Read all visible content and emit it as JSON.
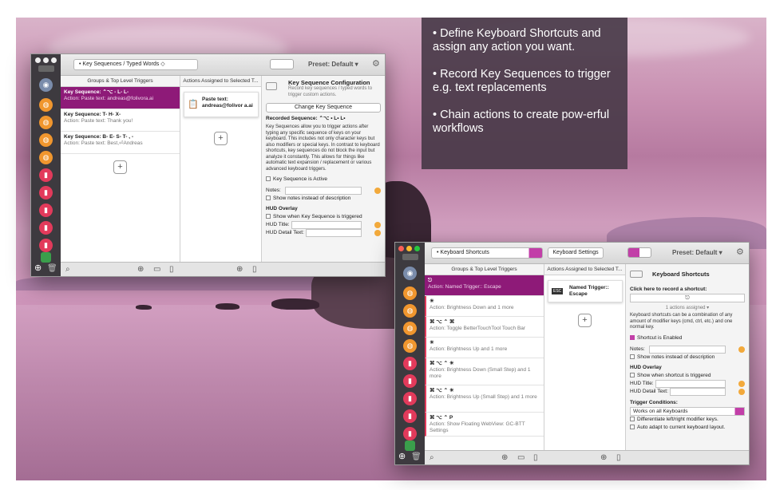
{
  "promo": {
    "bullets": [
      "• Define Keyboard Shortcuts and assign any action you want.",
      "• Record Key Sequences to trigger e.g. text replacements",
      "• Chain actions to create pow-erful workflows"
    ]
  },
  "win1": {
    "dropdown": "• Key Sequences / Typed Words ◇",
    "preset": "Preset: Default ▾",
    "col1_header": "Groups & Top Level Triggers",
    "col2_header": "Actions Assigned to Selected T...",
    "triggers": [
      {
        "title": "Key Sequence: ⌃⌥ - L- L-",
        "action": "Action: Paste text: andreas@folivora.ai"
      },
      {
        "title": "Key Sequence: T- H- X-",
        "action": "Action: Paste text: Thank you!"
      },
      {
        "title": "Key Sequence: B- E- S- T- , -",
        "action": "Action: Paste text: Best,⏎Andreas"
      }
    ],
    "action_item": "Paste text: andreas@folivor a.ai",
    "config": {
      "title": "Key Sequence Configuration",
      "subtitle": "Record key sequences / typed words to trigger custom actions.",
      "change_button": "Change Key Sequence",
      "recorded": "Recorded Sequence: ⌃⌥ • L• L•",
      "description": "Key Sequences allow you to trigger actions after typing any specific sequence of keys on your keyboard. This includes not only character keys but also modifiers or special keys. In contrast to keyboard shortcuts, key sequences do not block the input but analyze it constantly. This allows for things like automatic text expansion / replacement or various advanced keyboard triggers.",
      "active_label": "Key Sequence is Active",
      "notes_label": "Notes:",
      "show_notes": "Show notes instead of description",
      "hud_header": "HUD Overlay",
      "hud_show": "Show when Key Sequence is triggered",
      "hud_title": "HUD Title:",
      "hud_detail": "HUD Detail Text:"
    }
  },
  "win2": {
    "dropdown": "• Keyboard Shortcuts",
    "settings_button": "Keyboard Settings",
    "preset": "Preset: Default ▾",
    "col1_header": "Groups & Top Level Triggers",
    "col2_header": "Actions Assigned to Selected T...",
    "triggers": [
      {
        "title": "⎋",
        "action": "Action: Named Trigger:: Escape"
      },
      {
        "title": "☀",
        "action": "Action: Brightness Down and 1 more"
      },
      {
        "title": "⌘ ⌥ ⌃ ⌘",
        "action": "Action: Toggle BetterTouchTool Touch Bar"
      },
      {
        "title": "☀",
        "action": "Action: Brightness Up and 1 more"
      },
      {
        "title": "⌘ ⌥ ⌃ ☀",
        "action": "Action: Brightness Down (Small Step) and 1 more"
      },
      {
        "title": "⌘ ⌥ ⌃ ☀",
        "action": "Action: Brightness Up (Small Step) and 1 more"
      },
      {
        "title": "⌘ ⌥ ⌃ P",
        "action": "Action: Show Floating WebView: GC-BTT Settings"
      }
    ],
    "action_item": "Named Trigger:: Escape",
    "action_badge": "ESC",
    "config": {
      "title": "Keyboard Shortcuts",
      "record_label": "Click here to record a shortcut:",
      "record_value": "⎋",
      "actions_assigned": "1 actions assigned ▾",
      "description": "Keyboard shortcuts can be a combination of any amount of modifier keys (cmd, ctrl, etc.) and one normal key.",
      "enabled_label": "Shortcut is Enabled",
      "notes_label": "Notes:",
      "show_notes": "Show notes instead of description",
      "hud_header": "HUD Overlay",
      "hud_show": "Show when shortcut is triggered",
      "hud_title": "HUD Title:",
      "hud_detail": "HUD Detail Text:",
      "conditions_header": "Trigger Conditions:",
      "conditions_value": "Works on all Keyboards",
      "diff_label": "Differentiate left/right modifier keys.",
      "auto_label": "Auto adapt to current keyboard layout."
    }
  },
  "colors": {
    "accent": "#8e1a78",
    "dock": "#3d3a3f",
    "note_bg": "#463746"
  }
}
